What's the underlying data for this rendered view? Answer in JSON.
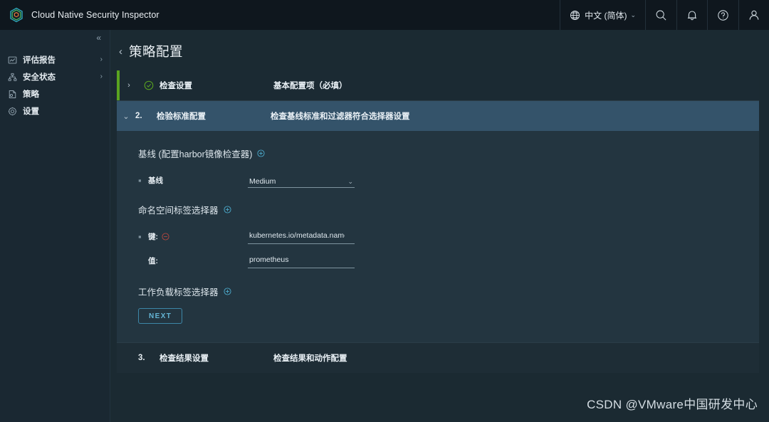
{
  "header": {
    "brand_title": "Cloud Native Security Inspector",
    "logo_icon": "shield-hexagon-logo",
    "language": {
      "globe_icon": "globe-icon",
      "label": "中文 (简体)",
      "caret_icon": "chevron-down-icon"
    },
    "actions": [
      {
        "name": "search-icon",
        "icon": "search-icon"
      },
      {
        "name": "notifications-icon",
        "icon": "bell-icon"
      },
      {
        "name": "help-icon",
        "icon": "question-circle-icon"
      },
      {
        "name": "user-icon",
        "icon": "user-icon"
      }
    ]
  },
  "sidebar": {
    "collapse_icon": "double-chevron-left-icon",
    "items": [
      {
        "label": "评估报告",
        "icon": "chart-report-icon",
        "chevron": "›",
        "has_chevron": true
      },
      {
        "label": "安全状态",
        "icon": "nodes-tree-icon",
        "chevron": "›",
        "has_chevron": true
      },
      {
        "label": "策略",
        "icon": "policy-document-icon",
        "chevron": "",
        "has_chevron": false
      },
      {
        "label": "设置",
        "icon": "gear-icon",
        "chevron": "",
        "has_chevron": false
      }
    ]
  },
  "main": {
    "back_icon": "chevron-left-icon",
    "page_title": "策略配置",
    "accordion": [
      {
        "toggle_icon": "chevron-right-icon",
        "toggle_glyph": "›",
        "status_icon": "check-circle-icon",
        "number": "",
        "name": "检查设置",
        "description": "基本配置项（必填）",
        "state": "complete"
      },
      {
        "toggle_icon": "chevron-down-icon",
        "toggle_glyph": "⌄",
        "status_icon": "",
        "number": "2.",
        "name": "检验标准配置",
        "description": "检查基线标准和过滤器符合选择器设置",
        "state": "expanded"
      },
      {
        "toggle_icon": "",
        "toggle_glyph": "",
        "status_icon": "",
        "number": "3.",
        "name": "检查结果设置",
        "description": "检查结果和动作配置",
        "state": "collapsed"
      }
    ],
    "form": {
      "baseline_group": {
        "title": "基线 (配置harbor镜像检查器)",
        "add_icon": "plus-circle-icon",
        "bullet": "▪",
        "field_label": "基线",
        "select_value": "Medium",
        "select_caret": "chevron-down-icon"
      },
      "namespace_group": {
        "title": "命名空间标签选择器",
        "add_icon": "plus-circle-icon",
        "bullet": "▪",
        "key_label": "键:",
        "remove_icon": "minus-circle-icon",
        "key_value": "kubernetes.io/metadata.name",
        "value_label": "值:",
        "value_value": "prometheus"
      },
      "workload_group": {
        "title": "工作负载标签选择器",
        "add_icon": "plus-circle-icon"
      },
      "next_button": "NEXT"
    }
  },
  "watermark": "CSDN @VMware中国研发中心",
  "colors": {
    "page_bg": "#1b2a32",
    "header_bg": "#0f171e",
    "sidebar_bg": "#1a2832",
    "panel_bg": "#233540",
    "row_active_bg": "#34536a",
    "accent_green": "#5aa420",
    "accent_blue": "#4ba8c9",
    "accent_red": "#b5473f"
  }
}
